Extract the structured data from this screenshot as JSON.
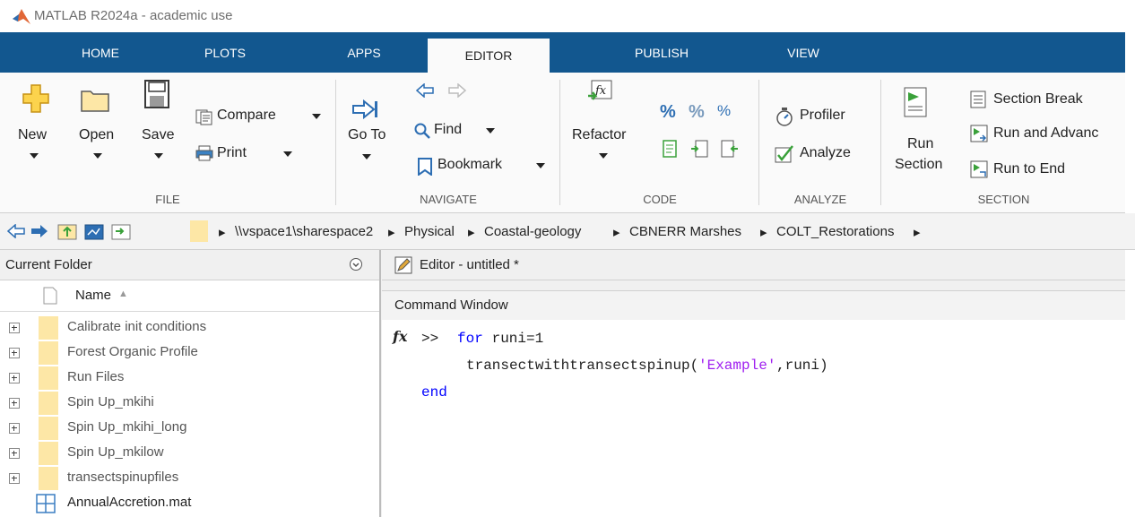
{
  "window": {
    "title": "MATLAB R2024a - academic use"
  },
  "tabs": [
    {
      "label": "HOME"
    },
    {
      "label": "PLOTS"
    },
    {
      "label": "APPS"
    },
    {
      "label": "EDITOR"
    },
    {
      "label": "PUBLISH"
    },
    {
      "label": "VIEW"
    }
  ],
  "active_tab": "EDITOR",
  "ribbon": {
    "file": {
      "label": "FILE",
      "new": "New",
      "open": "Open",
      "save": "Save",
      "compare": "Compare",
      "print": "Print"
    },
    "navigate": {
      "label": "NAVIGATE",
      "goto_1": "Go To",
      "find": "Find",
      "bookmark": "Bookmark"
    },
    "code": {
      "label": "CODE",
      "refactor": "Refactor"
    },
    "analyze": {
      "label": "ANALYZE",
      "profiler": "Profiler",
      "analyze": "Analyze"
    },
    "section": {
      "label": "SECTION",
      "run_section_1": "Run",
      "run_section_2": "Section",
      "section_break": "Section Break",
      "run_and_advance": "Run and Advanc",
      "run_to_end": "Run to End"
    }
  },
  "address": {
    "crumbs": [
      "\\\\vspace1\\sharespace2",
      "Physical",
      "Coastal-geology",
      "CBNERR Marshes",
      "COLT_Restorations"
    ]
  },
  "folder_pane": {
    "title": "Current Folder",
    "name_header": "Name",
    "items": [
      {
        "name": "Calibrate init conditions",
        "type": "folder"
      },
      {
        "name": "Forest Organic Profile",
        "type": "folder"
      },
      {
        "name": "Run Files",
        "type": "folder"
      },
      {
        "name": "Spin Up_mkihi",
        "type": "folder"
      },
      {
        "name": "Spin Up_mkihi_long",
        "type": "folder"
      },
      {
        "name": "Spin Up_mkilow",
        "type": "folder"
      },
      {
        "name": "transectspinupfiles",
        "type": "folder"
      },
      {
        "name": "AnnualAccretion.mat",
        "type": "mat"
      }
    ]
  },
  "editor": {
    "title": "Editor - untitled *"
  },
  "command_window": {
    "title": "Command Window",
    "prompt": ">>",
    "line1_kw": "for",
    "line1_rest": " runi=1",
    "line2_fn": "transectwithtransectspinup(",
    "line2_str": "'Example'",
    "line2_rest": ",runi)",
    "line3_kw": "end"
  },
  "colors": {
    "tab_bar": "#12578f",
    "keyword": "#0000ff",
    "string": "#a020f0"
  }
}
